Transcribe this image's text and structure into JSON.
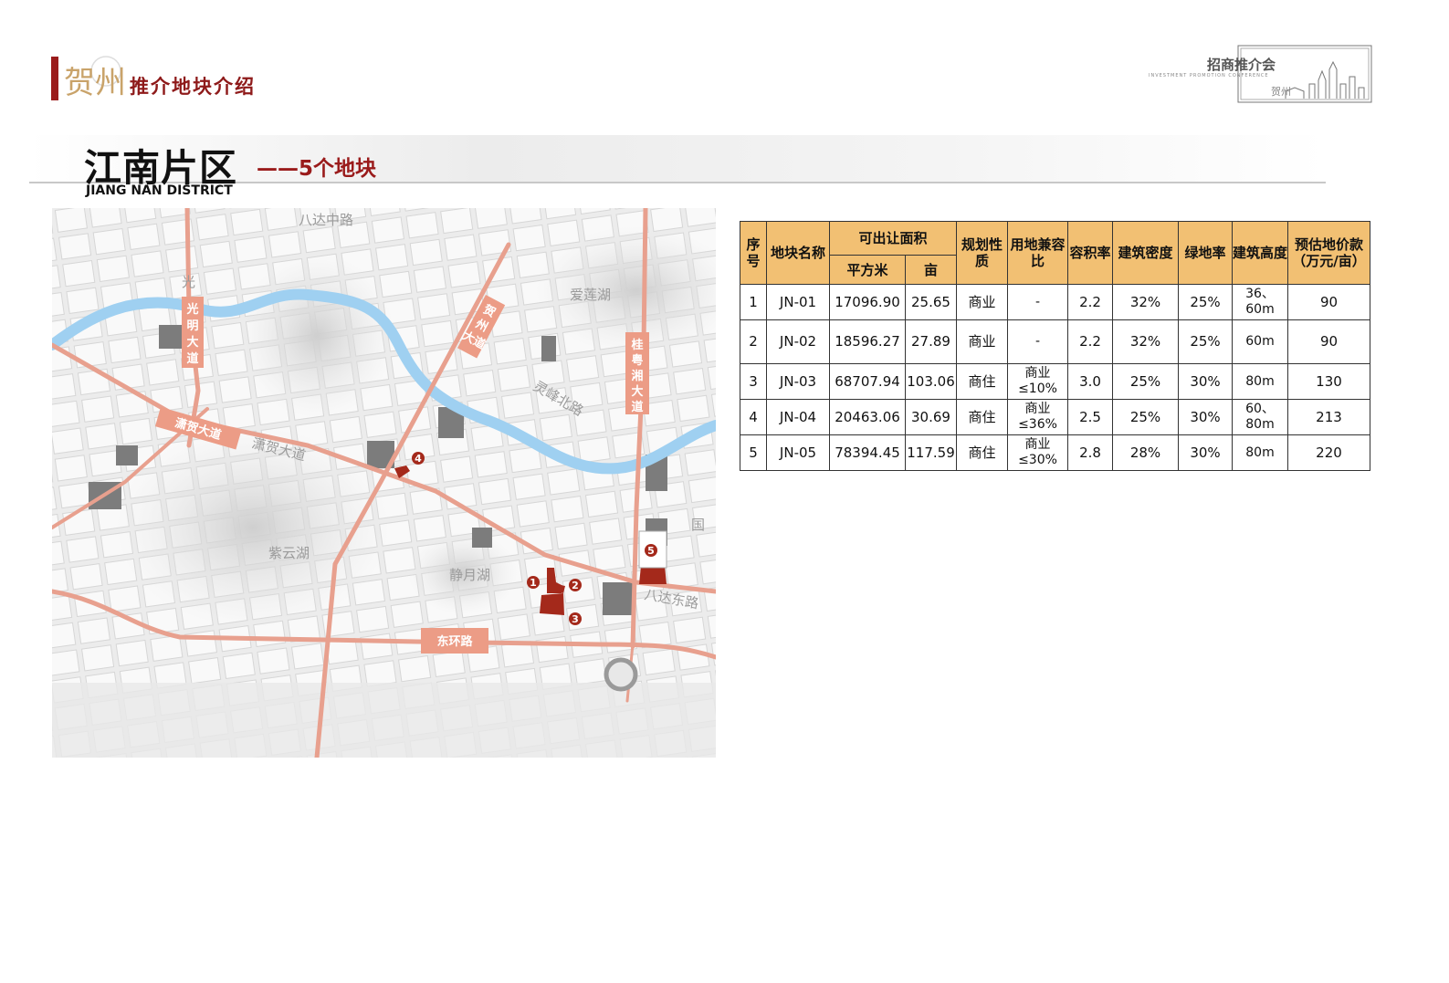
{
  "header": {
    "brand_logo_text": "贺州",
    "brand_caption": "推介地块介绍",
    "corner_title": "招商推介会",
    "corner_subtitle": "INVESTMENT PROMOTION CONFERENCE",
    "corner_mark": "贺州"
  },
  "section": {
    "title_cn": "江南片区",
    "subtitle": "——5个地块",
    "title_en": "JIANG NAN DISTRICT"
  },
  "map": {
    "road_labels": [
      "光明大道",
      "贺州大道",
      "桂粤湘大道",
      "潇贺大道",
      "东环路"
    ],
    "place_labels": [
      "八达中路",
      "爱莲湖",
      "紫云湖",
      "静月湖",
      "潇贺大道",
      "灵峰北路",
      "光",
      "国",
      "八达东路"
    ],
    "plot_markers": [
      "1",
      "2",
      "3",
      "4",
      "5"
    ]
  },
  "table": {
    "headers": {
      "index": "序号",
      "name": "地块名称",
      "area_group": "可出让面积",
      "area_sqm": "平方米",
      "area_mu": "亩",
      "use": "规划性质",
      "mixed": "用地兼容比",
      "far": "容积率",
      "density": "建筑密度",
      "green": "绿地率",
      "height": "建筑高度",
      "price": "预估地价款（万元/亩）"
    },
    "rows": [
      {
        "index": "1",
        "name": "JN-01",
        "sqm": "17096.90",
        "mu": "25.65",
        "use": "商业",
        "mixed": "-",
        "far": "2.2",
        "density": "32%",
        "green": "25%",
        "height": "36、60m",
        "price": "90"
      },
      {
        "index": "2",
        "name": "JN-02",
        "sqm": "18596.27",
        "mu": "27.89",
        "use": "商业",
        "mixed": "-",
        "far": "2.2",
        "density": "32%",
        "green": "25%",
        "height": "60m",
        "price": "90"
      },
      {
        "index": "3",
        "name": "JN-03",
        "sqm": "68707.94",
        "mu": "103.06",
        "use": "商住",
        "mixed": "商业≤10%",
        "far": "3.0",
        "density": "25%",
        "green": "30%",
        "height": "80m",
        "price": "130"
      },
      {
        "index": "4",
        "name": "JN-04",
        "sqm": "20463.06",
        "mu": "30.69",
        "use": "商住",
        "mixed": "商业≤36%",
        "far": "2.5",
        "density": "25%",
        "green": "30%",
        "height": "60、80m",
        "price": "213"
      },
      {
        "index": "5",
        "name": "JN-05",
        "sqm": "78394.45",
        "mu": "117.59",
        "use": "商住",
        "mixed": "商业≤30%",
        "far": "2.8",
        "density": "28%",
        "green": "30%",
        "height": "80m",
        "price": "220"
      }
    ]
  },
  "colors": {
    "accent": "#9a1b1b",
    "table_header": "#f2c073",
    "road": "#e8a08e",
    "road_label_bg": "#ec9c86",
    "river": "#9fd0f1",
    "plot": "#a4291b"
  }
}
